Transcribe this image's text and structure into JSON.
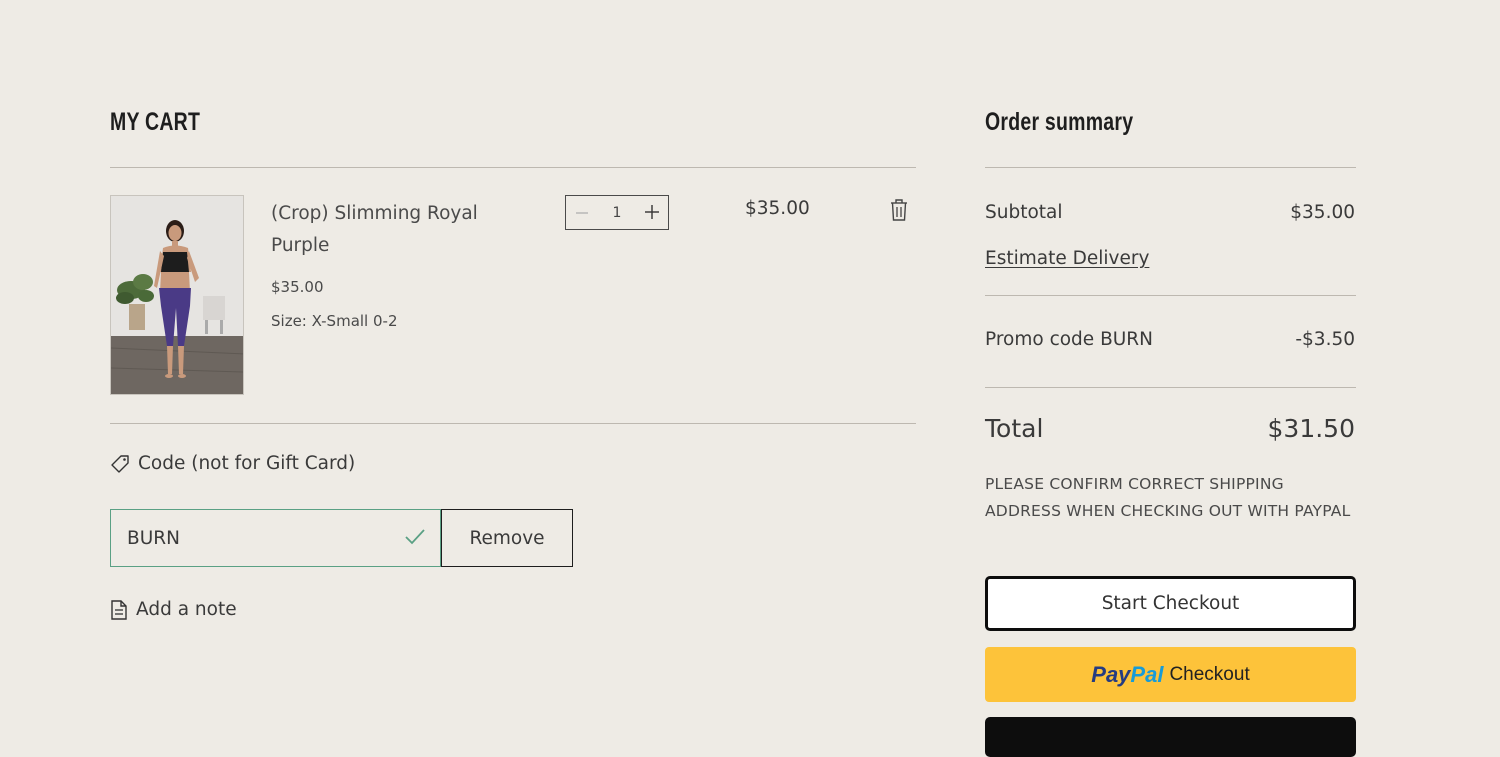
{
  "cart": {
    "title": "MY CART",
    "items": [
      {
        "name": "(Crop) Slimming Royal Purple",
        "price": "$35.00",
        "size": "Size: X-Small 0-2",
        "quantity": "1",
        "line_total": "$35.00"
      }
    ],
    "code_label": "Code (not for Gift Card)",
    "code_value": "BURN",
    "remove_label": "Remove",
    "add_note_label": "Add a note"
  },
  "summary": {
    "title": "Order summary",
    "subtotal_label": "Subtotal",
    "subtotal_value": "$35.00",
    "delivery_link": "Estimate Delivery",
    "promo_label": "Promo code BURN",
    "promo_value": "-$3.50",
    "total_label": "Total",
    "total_value": "$31.50",
    "note": "PLEASE CONFIRM CORRECT SHIPPING ADDRESS WHEN CHECKING OUT WITH PAYPAL",
    "checkout_label": "Start Checkout",
    "paypal_logo_part1": "Pay",
    "paypal_logo_part2": "Pal",
    "paypal_label": "Checkout"
  },
  "icons": {
    "tag": "tag-icon",
    "check": "check-icon",
    "note": "note-icon",
    "trash": "trash-icon",
    "minus": "minus-icon",
    "plus": "plus-icon"
  },
  "colors": {
    "background": "#eeebe5",
    "paypal_yellow": "#fdc33a",
    "paypal_dark_blue": "#253b80",
    "paypal_light_blue": "#179bd7",
    "valid_green": "#5aa084"
  }
}
